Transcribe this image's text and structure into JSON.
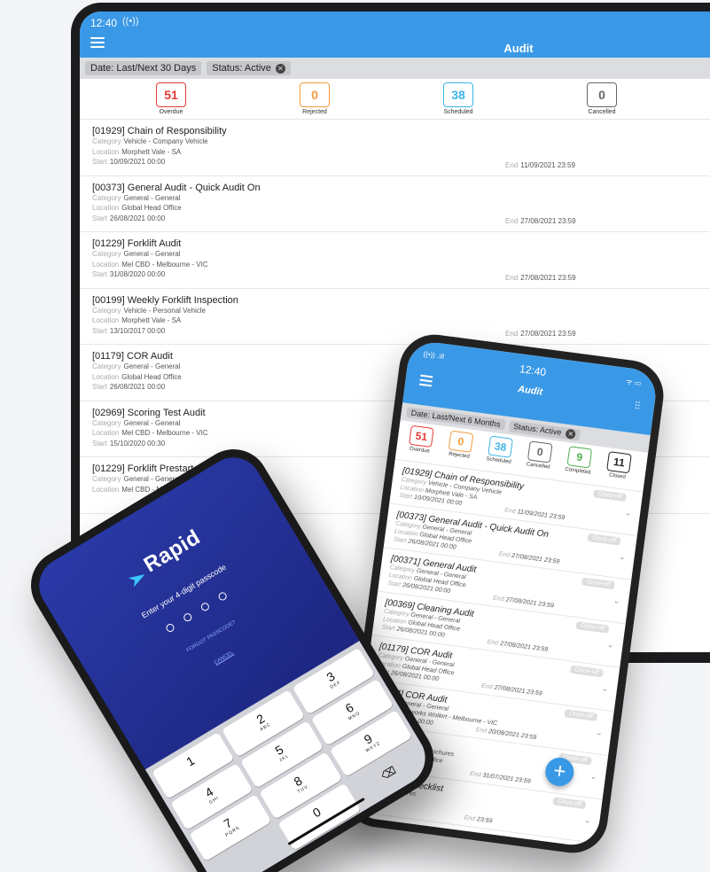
{
  "tablet": {
    "status_time": "12:40",
    "status_signal": "((•))",
    "title": "Audit",
    "filters": [
      "Date: Last/Next 30 Days",
      "Status: Active"
    ],
    "stats": [
      {
        "value": "51",
        "label": "Overdue",
        "color": "#e53935"
      },
      {
        "value": "0",
        "label": "Rejected",
        "color": "#f39a3c"
      },
      {
        "value": "38",
        "label": "Scheduled",
        "color": "#3eb4e6"
      },
      {
        "value": "0",
        "label": "Cancelled",
        "color": "#666666"
      }
    ],
    "labels": {
      "category": "Category",
      "location": "Location",
      "start": "Start",
      "end": "End"
    },
    "audits": [
      {
        "title": "[01929] Chain of Responsibility",
        "category": "Vehicle - Company Vehicle",
        "location": "Morphett Vale - SA",
        "start": "10/09/2021 00:00",
        "end": "11/09/2021 23:59"
      },
      {
        "title": "[00373] General Audit - Quick Audit On",
        "category": "General - General",
        "location": "Global Head Office",
        "start": "26/08/2021 00:00",
        "end": "27/08/2021 23:59"
      },
      {
        "title": "[01229] Forklift Audit",
        "category": "General - General",
        "location": "Mel CBD - Melbourne - VIC",
        "start": "31/08/2020 00:00",
        "end": "27/08/2021 23:59"
      },
      {
        "title": "[00199] Weekly Forklift Inspection",
        "category": "Vehicle - Personal Vehicle",
        "location": "Morphett Vale - SA",
        "start": "13/10/2017 00:00",
        "end": "27/08/2021 23:59"
      },
      {
        "title": "[01179] COR Audit",
        "category": "General - General",
        "location": "Global Head Office",
        "start": "26/08/2021 00:00",
        "end": ""
      },
      {
        "title": "[02969] Scoring Test Audit",
        "category": "General - General",
        "location": "Mel CBD - Melbourne - VIC",
        "start": "15/10/2020 00:30",
        "end": ""
      },
      {
        "title": "[01229] Forklift Prestart",
        "category": "General - General",
        "location": "Mel CBD - Melbourne - VIC",
        "start": "",
        "end": ""
      }
    ]
  },
  "phone_list": {
    "status_time": "12:40",
    "status_signal": "((•)) .ıll",
    "status_right": "ᯤ ▭",
    "title": "Audit",
    "filter_icon": "sliders-icon",
    "filters": [
      "Date: Last/Next 6 Months",
      "Status: Active"
    ],
    "stats": [
      {
        "value": "51",
        "label": "Overdue",
        "color": "#e53935"
      },
      {
        "value": "0",
        "label": "Rejected",
        "color": "#f39a3c"
      },
      {
        "value": "38",
        "label": "Scheduled",
        "color": "#3eb4e6"
      },
      {
        "value": "0",
        "label": "Cancelled",
        "color": "#666666"
      },
      {
        "value": "9",
        "label": "Completed",
        "color": "#4caf50"
      },
      {
        "value": "11",
        "label": "Closed",
        "color": "#222222"
      }
    ],
    "labels": {
      "category": "Category",
      "location": "Location",
      "start": "Start",
      "end": "End"
    },
    "badge": "Once-off",
    "audits": [
      {
        "title": "[01929] Chain of Responsibility",
        "category": "Vehicle - Company Vehicle",
        "location": "Morphett Vale - SA",
        "start": "10/09/2021 00:00",
        "end": "11/09/2021 23:59"
      },
      {
        "title": "[00373] General Audit - Quick Audit On",
        "category": "General - General",
        "location": "Global Head Office",
        "start": "26/08/2021 00:00",
        "end": "27/08/2021 23:59"
      },
      {
        "title": "[00371] General Audit",
        "category": "General - General",
        "location": "Global Head Office",
        "start": "26/08/2021 00:00",
        "end": "27/08/2021 23:59"
      },
      {
        "title": "[00369] Cleaning Audit",
        "category": "General - General",
        "location": "Global Head Office",
        "start": "26/08/2021 00:00",
        "end": "27/08/2021 23:59"
      },
      {
        "title": "[01179] COR Audit",
        "category": "General - General",
        "location": "Global Head Office",
        "start": "26/08/2021 00:00",
        "end": "27/08/2021 23:59"
      },
      {
        "title": "[02574] COR Audit",
        "category": "General - General",
        "location": "Brickworks Wollert - Melbourne - VIC",
        "start": "19/08/2021 00:00",
        "end": "20/08/2021 23:59"
      },
      {
        "title": "[...] COR Audit",
        "category": "Marketing - Brochures",
        "location": "Global Head Office",
        "start": "00:00",
        "end": "31/07/2021 23:59"
      },
      {
        "title": "...sentation Checklist",
        "category": "Brochures",
        "location": "",
        "start": "",
        "end": "23:59"
      }
    ],
    "fab_label": "+"
  },
  "phone_login": {
    "brand": "Rapid",
    "prompt": "Enter your 4-digit passcode",
    "forgot": "FORGOT PASSCODE?",
    "cancel": "CANCEL",
    "keys": [
      {
        "num": "1",
        "letters": ""
      },
      {
        "num": "2",
        "letters": "ABC"
      },
      {
        "num": "3",
        "letters": "DEF"
      },
      {
        "num": "4",
        "letters": "GHI"
      },
      {
        "num": "5",
        "letters": "JKL"
      },
      {
        "num": "6",
        "letters": "MNO"
      },
      {
        "num": "7",
        "letters": "PQRS"
      },
      {
        "num": "8",
        "letters": "TUV"
      },
      {
        "num": "9",
        "letters": "WXYZ"
      },
      {
        "num": "",
        "letters": ""
      },
      {
        "num": "0",
        "letters": ""
      },
      {
        "num": "⌫",
        "letters": ""
      }
    ]
  }
}
